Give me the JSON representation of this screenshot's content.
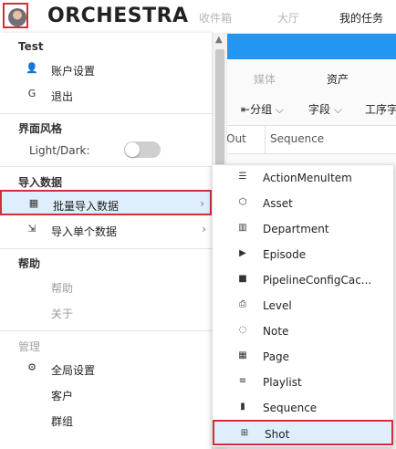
{
  "header": {
    "logo": "ORCHESTRA",
    "nav": [
      "收件箱",
      "大厅",
      "我的任务"
    ]
  },
  "background": {
    "tabs": [
      "媒体",
      "资产"
    ],
    "toolbar": [
      "分组",
      "字段",
      "工序字"
    ],
    "columns": [
      "ut Out",
      "Sequence"
    ]
  },
  "menu": {
    "user_section": "Test",
    "account": "账户设置",
    "logout": "退出",
    "style_section": "界面风格",
    "theme_label": "Light/Dark:",
    "theme_dark": false,
    "import_section": "导入数据",
    "batch_import": "批量导入数据",
    "single_import": "导入单个数据",
    "help_section": "帮助",
    "help": "帮助",
    "about": "关于",
    "admin_section": "管理",
    "global_settings": "全局设置",
    "clients": "客户",
    "groups": "群组"
  },
  "submenu": {
    "items": [
      {
        "label": "ActionMenuItem",
        "icon": "list-icon"
      },
      {
        "label": "Asset",
        "icon": "cube-icon"
      },
      {
        "label": "Department",
        "icon": "building-icon"
      },
      {
        "label": "Episode",
        "icon": "play-box-icon"
      },
      {
        "label": "PipelineConfigCac...",
        "icon": "folder-icon"
      },
      {
        "label": "Level",
        "icon": "level-icon"
      },
      {
        "label": "Note",
        "icon": "note-icon"
      },
      {
        "label": "Page",
        "icon": "grid-icon"
      },
      {
        "label": "Playlist",
        "icon": "playlist-icon"
      },
      {
        "label": "Sequence",
        "icon": "filmstrip-icon"
      },
      {
        "label": "Shot",
        "icon": "film-icon"
      }
    ],
    "selected": "Shot"
  },
  "colors": {
    "accent": "#2196f3",
    "selection": "#dfeefc",
    "highlight_border": "#d32f3b"
  }
}
